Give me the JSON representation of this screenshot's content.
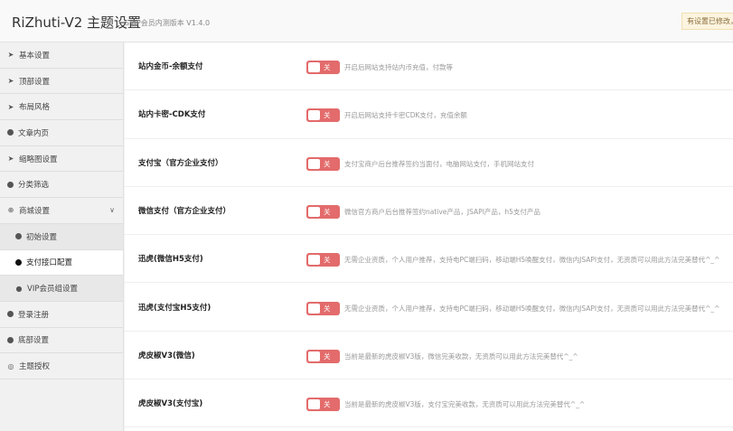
{
  "header": {
    "title": "RiZhuti-V2 主题设置",
    "version": "SVIP会员内测版本 V1.4.0",
    "notice": "有设置已修改，"
  },
  "sidebar": {
    "items": [
      {
        "label": "基本设置",
        "icon": "rocket-icon",
        "kind": "rocket"
      },
      {
        "label": "顶部设置",
        "icon": "rocket-icon",
        "kind": "rocket"
      },
      {
        "label": "布局风格",
        "icon": "rocket-icon",
        "kind": "rocket"
      },
      {
        "label": "文章内页",
        "icon": "dot-icon",
        "kind": "dot"
      },
      {
        "label": "缩略图设置",
        "icon": "rocket-icon",
        "kind": "rocket"
      },
      {
        "label": "分类筛选",
        "icon": "dot-icon",
        "kind": "dot"
      },
      {
        "label": "商城设置",
        "icon": "plus-circle-icon",
        "kind": "plus",
        "expanded": true
      },
      {
        "label": "初始设置",
        "icon": "dot-icon",
        "kind": "subdot"
      },
      {
        "label": "支付接口配置",
        "icon": "dot-icon",
        "kind": "subdot",
        "active": true
      },
      {
        "label": "VIP会员组设置",
        "icon": "user-icon",
        "kind": "subuser"
      },
      {
        "label": "登录注册",
        "icon": "dot-icon",
        "kind": "dot"
      },
      {
        "label": "底部设置",
        "icon": "dot-icon",
        "kind": "dot"
      },
      {
        "label": "主题授权",
        "icon": "eye-slash-icon",
        "kind": "eye"
      }
    ]
  },
  "settings": [
    {
      "label": "站内金币-余额支付",
      "toggle": "关",
      "desc": "开启后网站支持站内币充值，付款等"
    },
    {
      "label": "站内卡密-CDK支付",
      "toggle": "关",
      "desc": "开启后网站支持卡密CDK支付，充值余额"
    },
    {
      "label": "支付宝（官方企业支付）",
      "toggle": "关",
      "desc": "支付宝商户后台推荐签约当面付，电脑网站支付，手机网站支付"
    },
    {
      "label": "微信支付（官方企业支付）",
      "toggle": "关",
      "desc": "微信官方商户后台推荐签约native产品，JSAPI产品，h5支付产品"
    },
    {
      "label": "迅虎(微信H5支付)",
      "toggle": "关",
      "desc": "无需企业资质，个人用户推荐，支持电PC端扫码，移动端H5唤醒支付，微信内JSAPI支付，无资质可以用此方法完美替代^_^"
    },
    {
      "label": "迅虎(支付宝H5支付)",
      "toggle": "关",
      "desc": "无需企业资质，个人用户推荐，支持电PC端扫码，移动端H5唤醒支付，微信内JSAPI支付，无资质可以用此方法完美替代^_^"
    },
    {
      "label": "虎皮椒V3(微信)",
      "toggle": "关",
      "desc": "当前是最新的虎皮椒V3版，微信完美收款，无资质可以用此方法完美替代^_^"
    },
    {
      "label": "虎皮椒V3(支付宝)",
      "toggle": "关",
      "desc": "当前是最新的虎皮椒V3版，支付宝完美收款，无资质可以用此方法完美替代^_^"
    }
  ],
  "colors": {
    "toggle_off": "#e36b6b",
    "accent": "#e36b6b"
  }
}
